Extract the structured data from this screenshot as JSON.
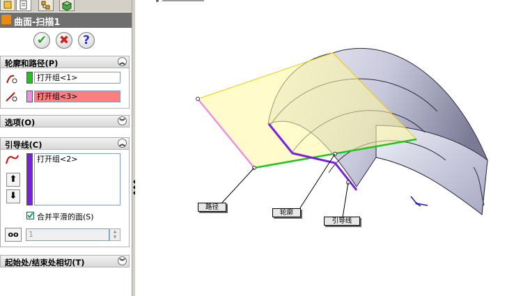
{
  "feature": {
    "title": "曲面-扫描1",
    "ok_symbol": "✔",
    "cancel_symbol": "✖",
    "help_symbol": "?"
  },
  "sections": {
    "profile_path": {
      "title": "轮廓和路径(P)",
      "profile_value": "打开组<1>",
      "path_value": "打开组<3>",
      "profile_color": "#1ec51e",
      "path_color": "#ee8ee0",
      "path_field_bg": "#ff7f7f"
    },
    "options": {
      "title": "选项(O)"
    },
    "guide_curves": {
      "title": "引导线(C)",
      "items": [
        "打开组<2>"
      ],
      "guide_color": "#7a1ee0",
      "merge_label": "合并平滑的面(S)",
      "merge_checked": true,
      "spin_value": "1"
    },
    "tangency": {
      "title": "起始处/结束处相切(T)"
    }
  },
  "viewport": {
    "callouts": {
      "path": "路径",
      "profile": "轮廓",
      "guide": "引导线"
    }
  }
}
